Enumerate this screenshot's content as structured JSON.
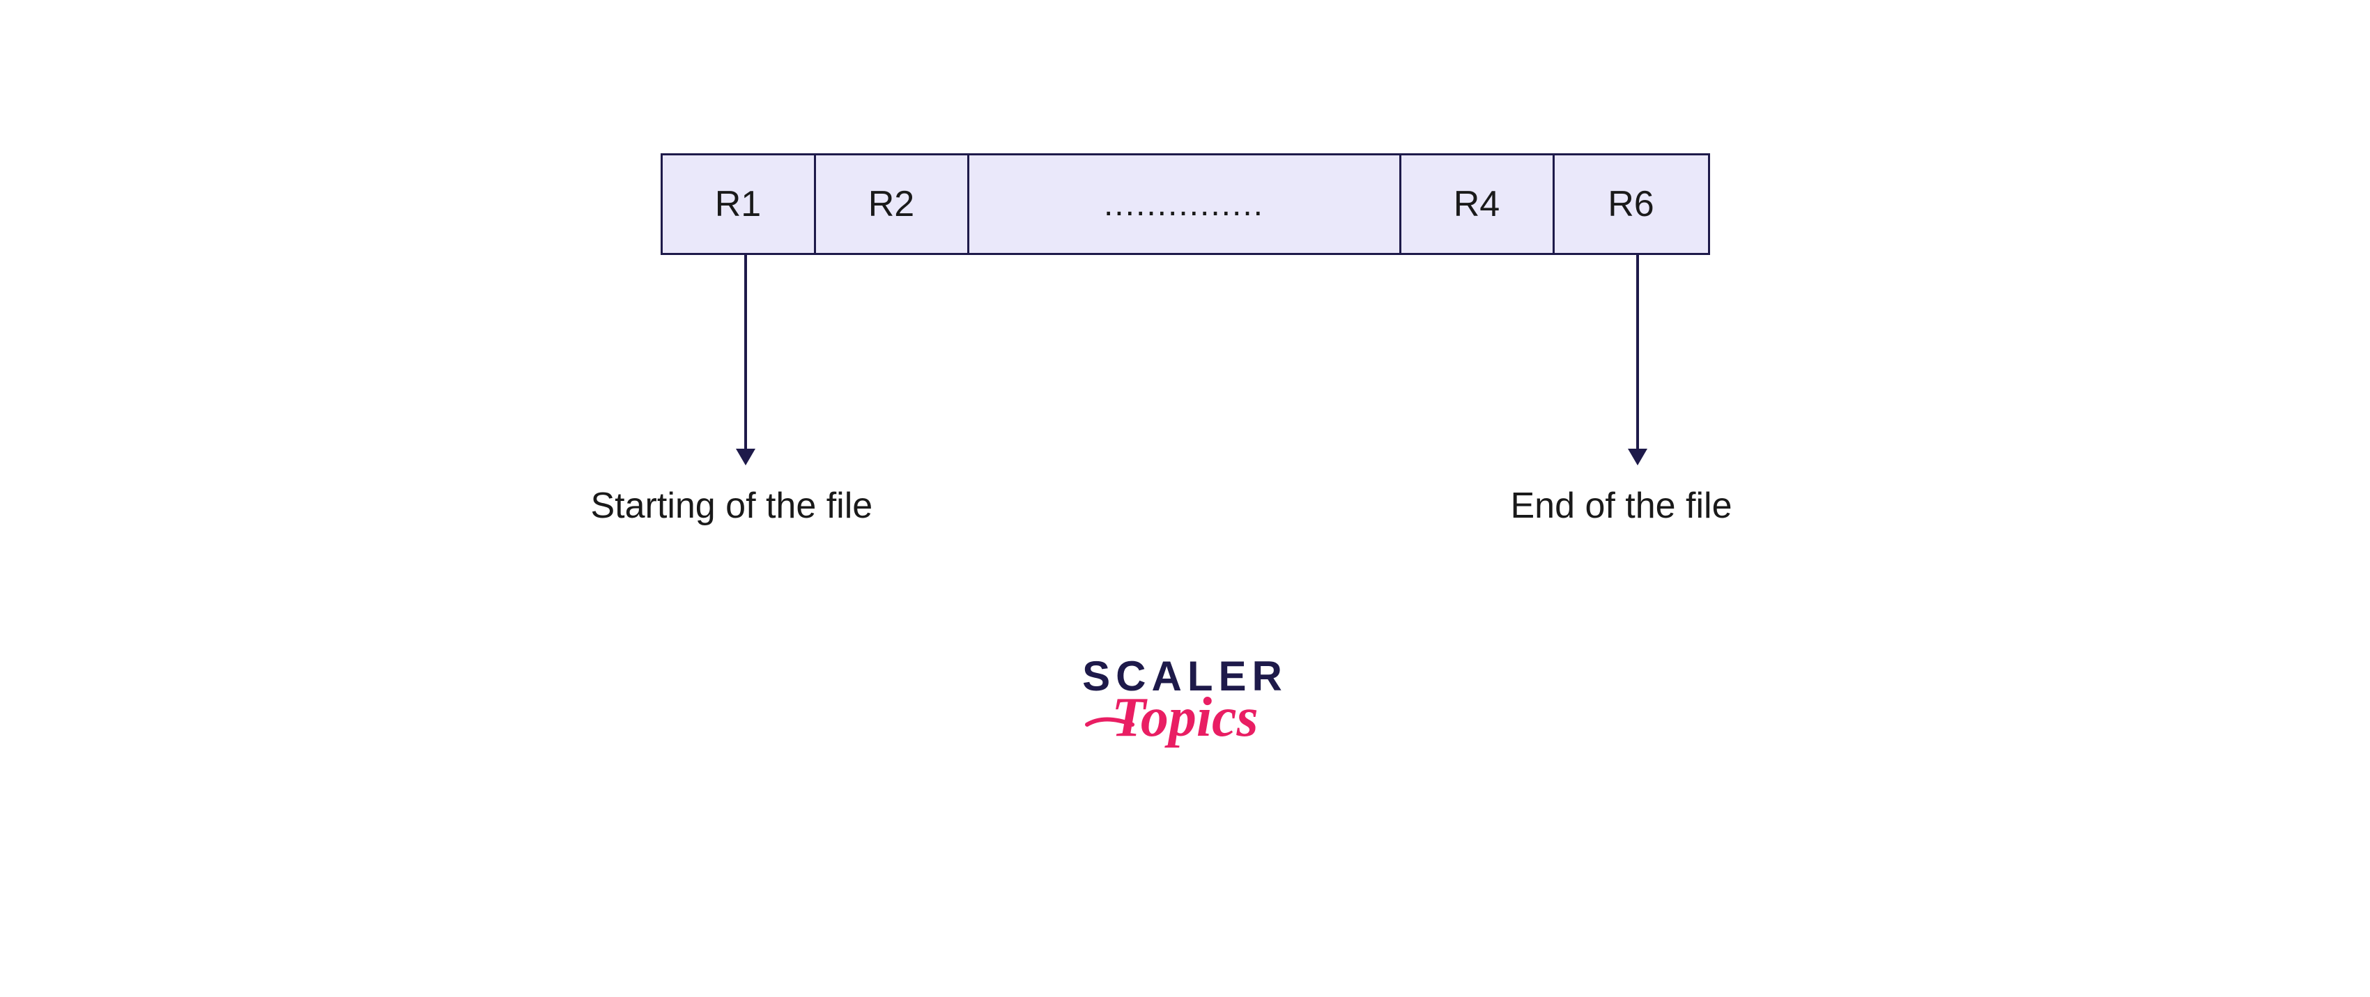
{
  "diagram": {
    "cells": {
      "r1": "R1",
      "r2": "R2",
      "dots": "...............",
      "r4": "R4",
      "r6": "R6"
    },
    "labels": {
      "start": "Starting of the file",
      "end": "End of the file"
    }
  },
  "branding": {
    "logo_main": "SCALER",
    "logo_sub": "Topics"
  },
  "colors": {
    "border": "#1e1a4a",
    "cell_fill": "#eae8fa",
    "text": "#1a1a1a",
    "accent": "#e91e63"
  }
}
